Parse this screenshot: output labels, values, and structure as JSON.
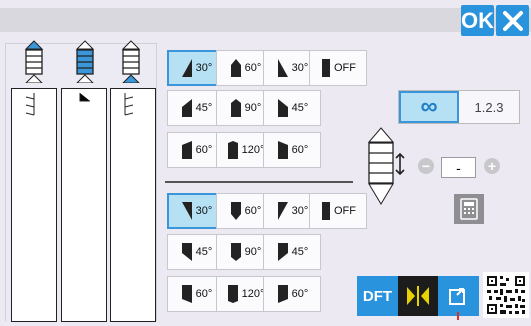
{
  "header": {
    "ok_label": "OK"
  },
  "left_panel": {
    "columns": [
      {
        "name": "column-1",
        "selected": false
      },
      {
        "name": "column-2",
        "selected": true
      },
      {
        "name": "column-3",
        "selected": false
      }
    ]
  },
  "top_grid": {
    "rows": [
      [
        "30°",
        "60°",
        "30°",
        "OFF"
      ],
      [
        "45°",
        "90°",
        "45°"
      ],
      [
        "60°",
        "120°",
        "60°"
      ]
    ],
    "selected": "30°-left"
  },
  "bottom_grid": {
    "rows": [
      [
        "30°",
        "60°",
        "30°",
        "OFF"
      ],
      [
        "45°",
        "90°",
        "45°"
      ],
      [
        "60°",
        "120°",
        "60°"
      ]
    ],
    "selected": "30°-left"
  },
  "repeat_mode": {
    "infinite_symbol": "∞",
    "count_label": "1.2.3",
    "selected": "infinite"
  },
  "stepper": {
    "minus": "−",
    "plus": "+",
    "value": "-"
  },
  "bottom_toolbar": {
    "dft_label": "DFT"
  },
  "colors": {
    "accent": "#2a93dd",
    "selected_fill": "#b6e0f4",
    "background": "#ece9f3"
  }
}
